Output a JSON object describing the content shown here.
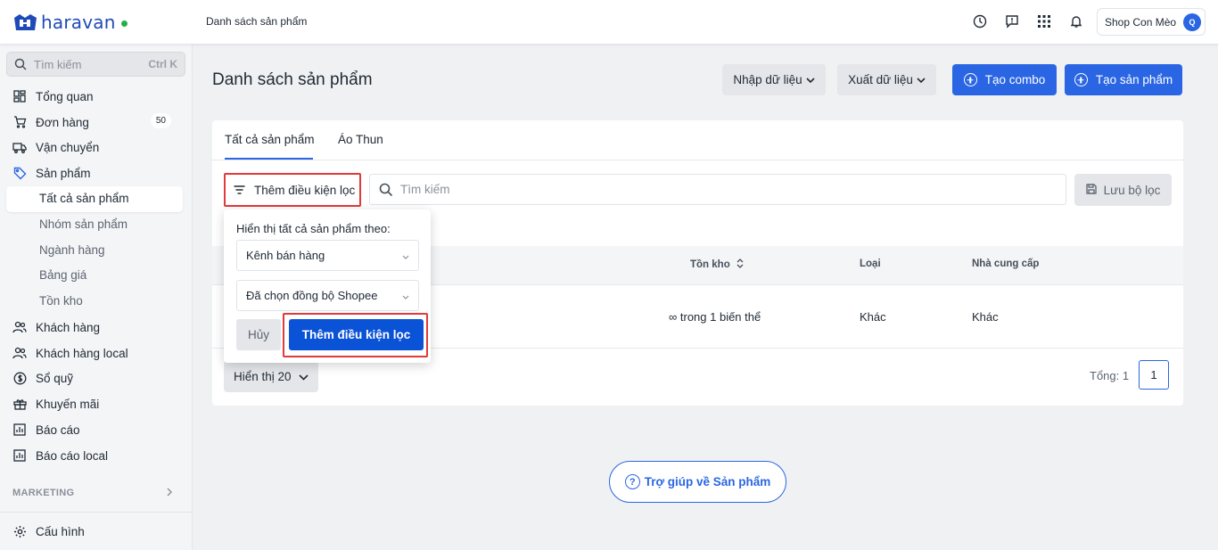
{
  "brand": {
    "name": "haravan",
    "accent": "#2a66e4",
    "status_dot": "#21b04b"
  },
  "topbar": {
    "breadcrumb": "Danh sách sản phẩm",
    "icons": [
      "clock-icon",
      "feedback-icon",
      "apps-grid-icon",
      "bell-icon"
    ],
    "shop_name": "Shop Con Mèo",
    "avatar_initial": "Q"
  },
  "sidebar": {
    "search_placeholder": "Tìm kiếm",
    "search_shortcut": "Ctrl K",
    "items": [
      {
        "label": "Tổng quan",
        "icon": "dashboard-icon"
      },
      {
        "label": "Đơn hàng",
        "icon": "cart-icon",
        "badge": "50"
      },
      {
        "label": "Vận chuyển",
        "icon": "truck-icon"
      },
      {
        "label": "Sản phẩm",
        "icon": "tag-icon"
      }
    ],
    "product_sub": [
      "Tất cả sản phẩm",
      "Nhóm sản phẩm",
      "Ngành hàng",
      "Bảng giá",
      "Tồn kho"
    ],
    "items2": [
      {
        "label": "Khách hàng",
        "icon": "users-icon"
      },
      {
        "label": "Khách hàng local",
        "icon": "users-icon"
      },
      {
        "label": "Sổ quỹ",
        "icon": "dollar-icon"
      },
      {
        "label": "Khuyến mãi",
        "icon": "gift-icon"
      },
      {
        "label": "Báo cáo",
        "icon": "chart-icon"
      },
      {
        "label": "Báo cáo local",
        "icon": "chart-icon"
      }
    ],
    "marketing_label": "MARKETING",
    "settings_label": "Cấu hình"
  },
  "main": {
    "title": "Danh sách sản phẩm",
    "import_label": "Nhập dữ liệu",
    "export_label": "Xuất dữ liệu",
    "create_combo_label": "Tạo combo",
    "create_product_label": "Tạo sản phẩm",
    "tabs": [
      "Tất cả sản phẩm",
      "Áo Thun"
    ],
    "add_filter_label": "Thêm điều kiện lọc",
    "search_placeholder": "Tìm kiếm",
    "save_filter_label": "Lưu bộ lọc",
    "columns": {
      "stock": "Tồn kho",
      "type": "Loại",
      "vendor": "Nhà cung cấp"
    },
    "row": {
      "stock": "∞ trong 1 biến thể",
      "type": "Khác",
      "vendor": "Khác"
    },
    "page_size_label": "Hiển thị 20",
    "total_label": "Tổng: 1",
    "current_page": "1",
    "help_label": "Trợ giúp về Sản phẩm"
  },
  "popover": {
    "label": "Hiển thị tất cả sản phẩm theo:",
    "select1": "Kênh bán hàng",
    "select2": "Đã chọn đồng bộ Shopee",
    "cancel_label": "Hủy",
    "apply_label": "Thêm điều kiện lọc"
  }
}
